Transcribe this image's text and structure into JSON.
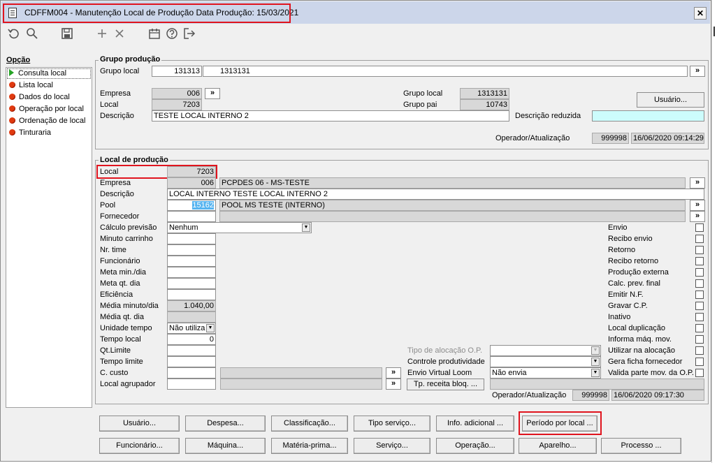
{
  "window": {
    "title": "CDFFM004 - Manutenção Local de Produção Data Produção: 15/03/2021",
    "close_glyph": "✕"
  },
  "toolbar": {
    "icons": [
      "undo-icon",
      "search-icon",
      "save-icon",
      "add-icon",
      "delete-icon",
      "calendar-icon",
      "help-icon",
      "exit-icon"
    ]
  },
  "sidebar": {
    "title": "Opção",
    "items": [
      {
        "label": "Consulta local"
      },
      {
        "label": "Lista local"
      },
      {
        "label": "Dados do local"
      },
      {
        "label": "Operação por local"
      },
      {
        "label": "Ordenação de local"
      },
      {
        "label": "Tinturaria"
      }
    ]
  },
  "grupo": {
    "section_title": "Grupo produção",
    "grupo_local_label": "Grupo local",
    "grupo_local_code": "131313",
    "grupo_local_name": "1313131",
    "empresa_label": "Empresa",
    "empresa_value": "006",
    "local_label": "Local",
    "local_value": "7203",
    "descricao_label": "Descrição",
    "descricao_value": "TESTE LOCAL INTERNO 2",
    "grupo_local2_label": "Grupo local",
    "grupo_local2_value": "1313131",
    "grupo_pai_label": "Grupo pai",
    "grupo_pai_value": "10743",
    "usuario_btn": "Usuário...",
    "desc_reduzida_label": "Descrição reduzida",
    "desc_reduzida_value": "",
    "operador_label": "Operador/Atualização",
    "operador_value": "999998",
    "atualizacao_value": "16/06/2020 09:14:29"
  },
  "local": {
    "section_title": "Local de produção",
    "local_label": "Local",
    "local_value": "7203",
    "empresa_label": "Empresa",
    "empresa_value": "006",
    "empresa_name": "PCPDES 06 - MS-TESTE",
    "descricao_label": "Descrição",
    "descricao_value": "LOCAL INTERNO TESTE LOCAL INTERNO 2",
    "pool_label": "Pool",
    "pool_value": "15162",
    "pool_name": "POOL MS TESTE (INTERNO)",
    "fornecedor_label": "Fornecedor",
    "calc_label": "Cálculo previsão",
    "calc_value": "Nenhum",
    "minuto_carrinho_label": "Minuto carrinho",
    "nr_time_label": "Nr. time",
    "funcionario_label": "Funcionário",
    "meta_min_label": "Meta min./dia",
    "meta_qt_label": "Meta qt. dia",
    "eficiencia_label": "Eficiência",
    "media_minuto_label": "Média minuto/dia",
    "media_minuto_value": "1.040,00",
    "media_qt_label": "Média qt. dia",
    "unidade_tempo_label": "Unidade tempo",
    "unidade_tempo_value": "Não utiliza",
    "tempo_local_label": "Tempo local",
    "tempo_local_value": "0",
    "qt_limite_label": "Qt.Limite",
    "tempo_limite_label": "Tempo limite",
    "c_custo_label": "C. custo",
    "local_agrupador_label": "Local agrupador",
    "tipo_alocacao_label": "Tipo de alocação O.P.",
    "controle_prod_label": "Controle produtividade",
    "envio_virtual_label": "Envio Virtual Loom",
    "envio_virtual_value": "Não envia",
    "tp_receita_btn": "Tp. receita bloq. ...",
    "operador_label": "Operador/Atualização",
    "operador_value": "999998",
    "atualizacao_value": "16/06/2020 09:17:30",
    "checks": [
      {
        "label": "Envio"
      },
      {
        "label": "Recibo envio"
      },
      {
        "label": "Retorno"
      },
      {
        "label": "Recibo retorno"
      },
      {
        "label": "Produção externa"
      },
      {
        "label": "Calc. prev. final"
      },
      {
        "label": "Emitir N.F."
      },
      {
        "label": "Gravar C.P."
      },
      {
        "label": "Inativo"
      },
      {
        "label": "Local duplicação"
      },
      {
        "label": "Informa máq. mov."
      },
      {
        "label": "Utilizar na alocação"
      },
      {
        "label": "Gera ficha fornecedor"
      },
      {
        "label": "Valida parte mov. da O.P."
      }
    ]
  },
  "buttons_row1": [
    {
      "label": "Usuário..."
    },
    {
      "label": "Despesa..."
    },
    {
      "label": "Classificação..."
    },
    {
      "label": "Tipo serviço..."
    },
    {
      "label": "Info. adicional ..."
    },
    {
      "label": "Período por local ..."
    }
  ],
  "buttons_row2": [
    {
      "label": "Funcionário..."
    },
    {
      "label": "Máquina..."
    },
    {
      "label": "Matéria-prima..."
    },
    {
      "label": "Serviço..."
    },
    {
      "label": "Operação..."
    },
    {
      "label": "Aparelho..."
    },
    {
      "label": "Processo ..."
    }
  ],
  "common": {
    "expand_glyph": "»",
    "dropdown_glyph": "▼"
  },
  "colors": {
    "highlight": "#e0141e",
    "titlebar": "#ccd6ea",
    "cyan_field": "#ccfcfc"
  }
}
